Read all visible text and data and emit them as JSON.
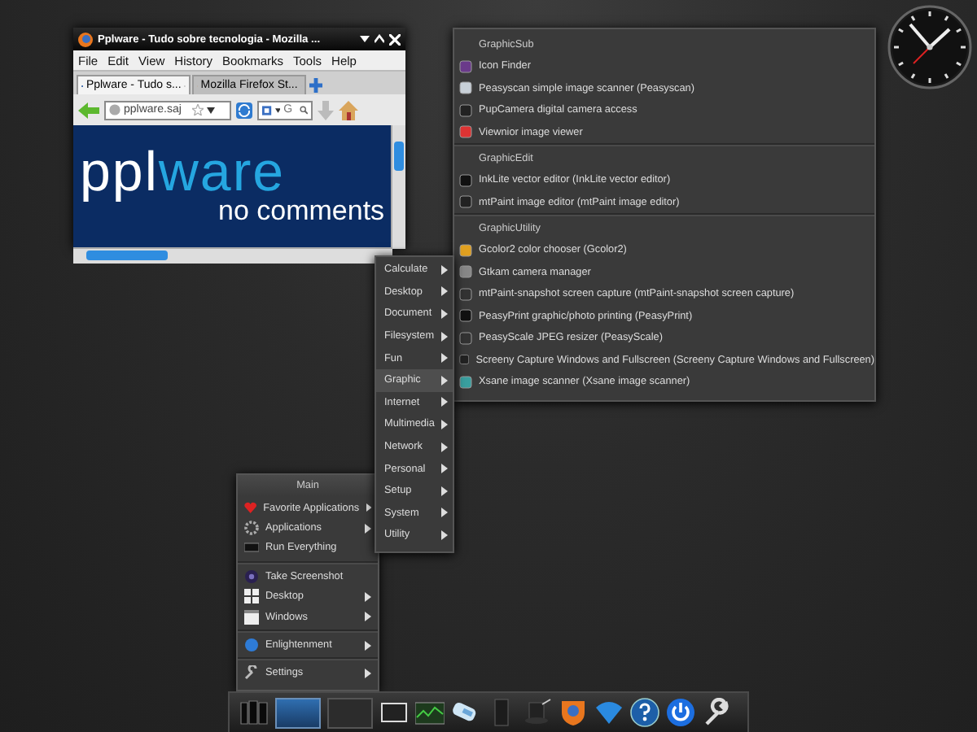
{
  "browser": {
    "title": "Pplware - Tudo sobre tecnologia - Mozilla ...",
    "menu": [
      "File",
      "Edit",
      "View",
      "History",
      "Bookmarks",
      "Tools",
      "Help"
    ],
    "tabs": [
      {
        "label": "Pplware - Tudo s...",
        "selected": true
      },
      {
        "label": "Mozilla Firefox St...",
        "selected": false
      }
    ],
    "address": "pplware.saj",
    "search": {
      "placeholder": "G"
    },
    "logo": {
      "text": "ppl",
      "highlight": "ware"
    },
    "tagline": "no comments"
  },
  "graphic_menu": [
    {
      "title": "GraphicSub",
      "items": [
        "Icon Finder",
        "Peasyscan simple image scanner (Peasyscan)",
        "PupCamera digital camera access",
        "Viewnior image viewer"
      ]
    },
    {
      "title": "GraphicEdit",
      "items": [
        "InkLite vector editor (InkLite vector editor)",
        "mtPaint image editor (mtPaint image editor)"
      ]
    },
    {
      "title": "GraphicUtility",
      "items": [
        "Gcolor2 color chooser (Gcolor2)",
        "Gtkam camera manager",
        "mtPaint-snapshot screen capture (mtPaint-snapshot screen capture)",
        "PeasyPrint graphic/photo printing (PeasyPrint)",
        "PeasyScale JPEG resizer (PeasyScale)",
        "Screeny Capture Windows and Fullscreen (Screeny Capture Windows and Fullscreen)",
        "Xsane image scanner (Xsane image scanner)"
      ]
    }
  ],
  "applications_menu": [
    {
      "label": "Calculate",
      "selected": false
    },
    {
      "label": "Desktop",
      "selected": false
    },
    {
      "label": "Document",
      "selected": false
    },
    {
      "label": "Filesystem",
      "selected": false
    },
    {
      "label": "Fun",
      "selected": false
    },
    {
      "label": "Graphic",
      "selected": true
    },
    {
      "label": "Internet",
      "selected": false
    },
    {
      "label": "Multimedia",
      "selected": false
    },
    {
      "label": "Network",
      "selected": false
    },
    {
      "label": "Personal",
      "selected": false
    },
    {
      "label": "Setup",
      "selected": false
    },
    {
      "label": "System",
      "selected": false
    },
    {
      "label": "Utility",
      "selected": false
    }
  ],
  "main_menu": {
    "title": "Main",
    "groups": [
      [
        {
          "label": "Favorite Applications",
          "submenu": true
        },
        {
          "label": "Applications",
          "submenu": true
        },
        {
          "label": "Run Everything",
          "submenu": false
        }
      ],
      [
        {
          "label": "Take Screenshot",
          "submenu": false
        },
        {
          "label": "Desktop",
          "submenu": true
        },
        {
          "label": "Windows",
          "submenu": true
        }
      ],
      [
        {
          "label": "Enlightenment",
          "submenu": true
        }
      ],
      [
        {
          "label": "Settings",
          "submenu": true
        }
      ]
    ]
  },
  "pager": [
    {
      "selected": true
    },
    {
      "selected": false
    }
  ]
}
